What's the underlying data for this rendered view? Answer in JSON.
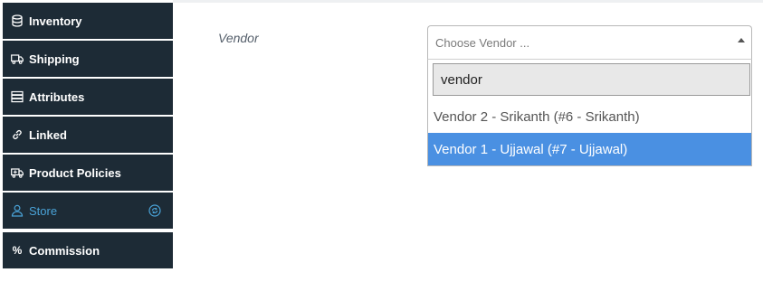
{
  "sidebar": {
    "items": [
      {
        "label": "Inventory",
        "icon": "database-icon"
      },
      {
        "label": "Shipping",
        "icon": "truck-icon"
      },
      {
        "label": "Attributes",
        "icon": "server-icon"
      },
      {
        "label": "Linked",
        "icon": "link-icon"
      },
      {
        "label": "Product Policies",
        "icon": "ambulance-icon"
      },
      {
        "label": "Store",
        "icon": "user-icon",
        "active": true,
        "aside_icon": "refresh-circle-icon"
      },
      {
        "label": "Commission",
        "icon": "percent-icon",
        "glyph": "%"
      }
    ],
    "bg_color": "#1d2b36",
    "active_color": "#4aa3d8"
  },
  "vendor_field": {
    "label": "Vendor",
    "placeholder": "Choose Vendor ...",
    "search_value": "vendor",
    "options": [
      {
        "label": "Vendor 2 - Srikanth (#6 - Srikanth)"
      },
      {
        "label": "Vendor 1 - Ujjawal (#7 - Ujjawal)",
        "highlighted": true
      }
    ],
    "highlight_color": "#4a90e2"
  }
}
